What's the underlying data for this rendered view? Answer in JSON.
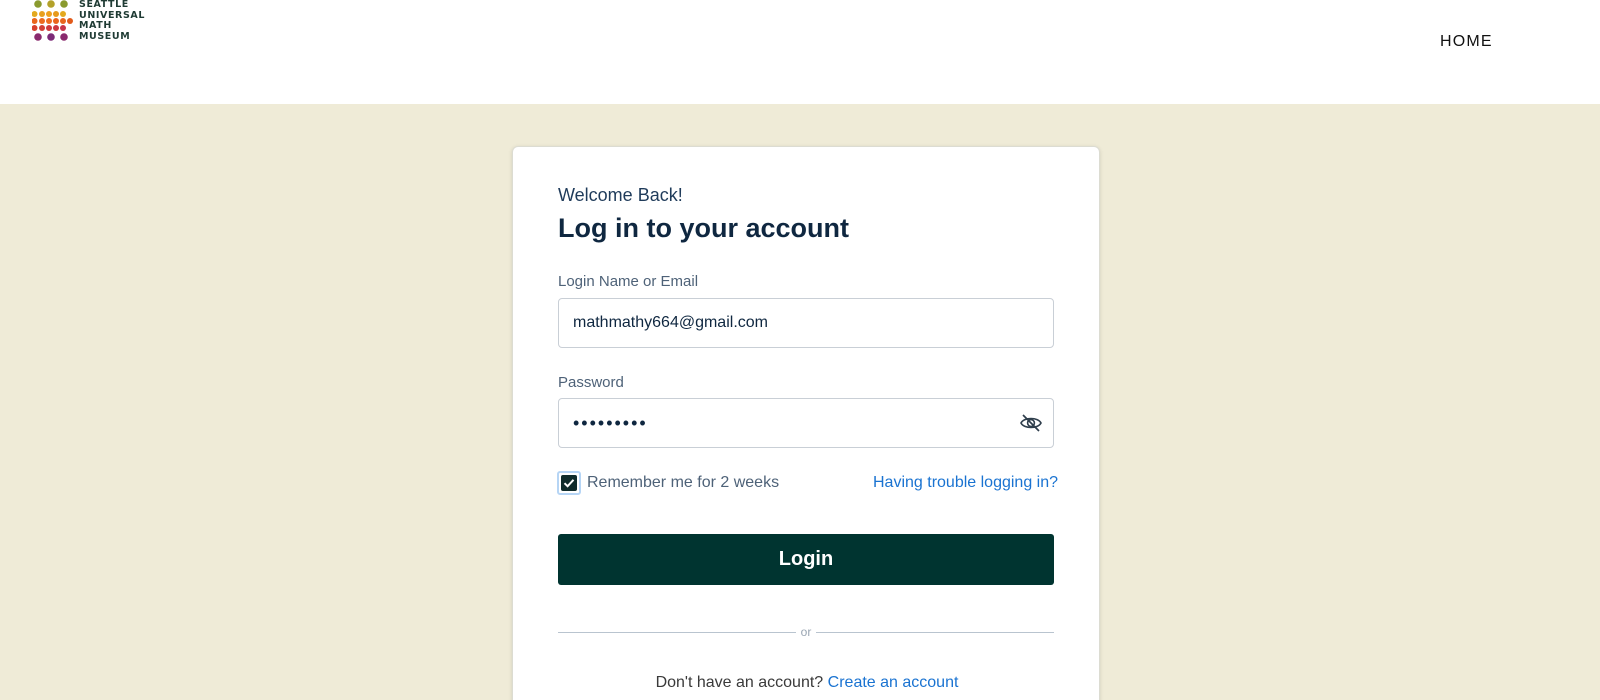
{
  "header": {
    "logo_lines": [
      "SEATTLE",
      "UNIVERSAL",
      "MATH",
      "MUSEUM"
    ],
    "nav_home": "HOME"
  },
  "login": {
    "welcome": "Welcome Back!",
    "title": "Log in to your account",
    "email_label": "Login Name or Email",
    "email_value": "mathmathy664@gmail.com",
    "password_label": "Password",
    "password_value": "•••••••••",
    "remember_label": "Remember me for 2 weeks",
    "remember_checked": true,
    "trouble_link": "Having trouble logging in?",
    "login_button": "Login",
    "divider_text": "or",
    "no_account_text": "Don't have an account?",
    "create_account_link": "Create an account"
  },
  "colors": {
    "background": "#efebd7",
    "button": "#003430",
    "link": "#1a73d1",
    "title": "#0f2740"
  }
}
